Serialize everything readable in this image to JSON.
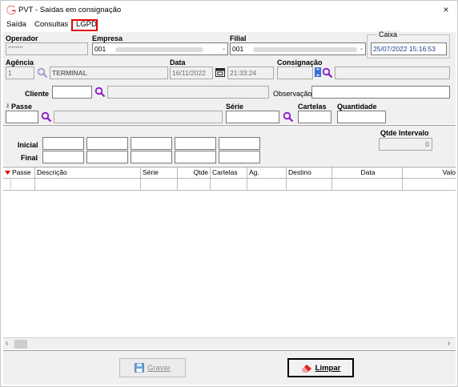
{
  "window": {
    "title": "PVT - Saídas em consignação",
    "close": "×"
  },
  "menu": {
    "items": [
      "Saída",
      "Consultas",
      "LGPD"
    ]
  },
  "form": {
    "operador_label": "Operador",
    "operador_value": "********",
    "empresa_label": "Empresa",
    "empresa_value": "001",
    "filial_label": "Filial",
    "filial_value": "001",
    "caixa_label": "Caixa",
    "caixa_value": "25/07/2022 15:16:53",
    "agencia_label": "Agência",
    "agencia_code": "1",
    "agencia_name": "TERMINAL",
    "data_label": "Data",
    "data_date": "16/11/2022",
    "data_time": "21:33:24",
    "consignacao_label": "Consignação",
    "cliente_label": "Cliente",
    "observacao_label": "Observação",
    "passe_label": "Passe",
    "serie_label": "Série",
    "cartelas_label": "Cartelas",
    "quantidade_label": "Quantidade"
  },
  "interval": {
    "inicial_label": "Inicial",
    "final_label": "Final",
    "qtde_intervalo_label": "Qtde Intervalo",
    "qtde_intervalo_value": "0"
  },
  "grid": {
    "columns": [
      "Passe",
      "Descrição",
      "Série",
      "Qtde",
      "Cartelas",
      "Ag.",
      "Destino",
      "Data",
      "Valo"
    ]
  },
  "buttons": {
    "gravar": "Gravar",
    "limpar": "Limpar"
  },
  "colors": {
    "highlight": "#e00000",
    "search": "#8a1bc9",
    "accent": "#1e5fbf"
  },
  "icons": [
    "app-logo-icon",
    "close-icon",
    "search-icon",
    "calendar-icon",
    "save-icon",
    "eraser-icon",
    "dropdown-arrow-icon",
    "scroll-left-icon",
    "scroll-right-icon"
  ]
}
